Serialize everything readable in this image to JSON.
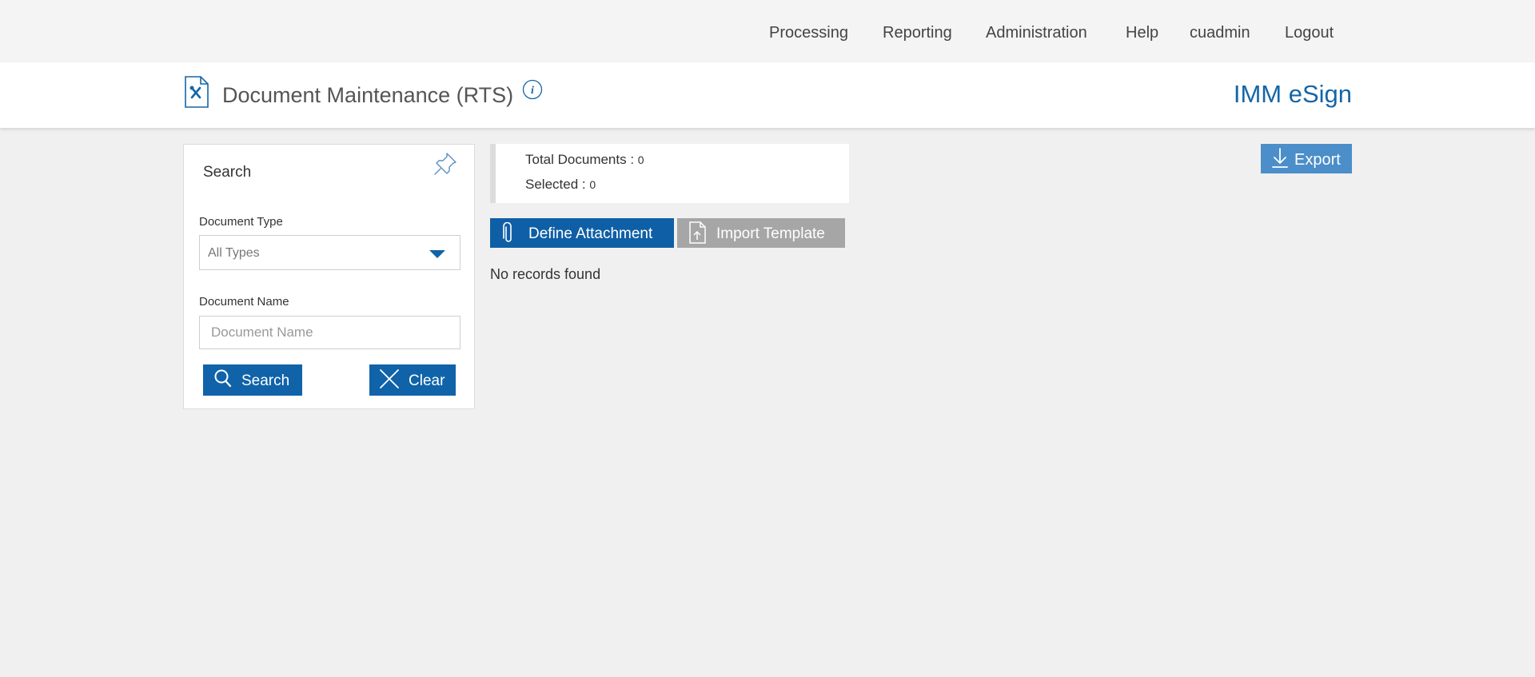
{
  "nav": {
    "items": [
      "Processing",
      "Reporting",
      "Administration",
      "Help",
      "cuadmin",
      "Logout"
    ]
  },
  "header": {
    "title": "Document Maintenance (RTS)",
    "brand": "IMM eSign",
    "icons": {
      "page": "document-tools-icon",
      "info": "info-icon"
    }
  },
  "search_panel": {
    "title": "Search",
    "pin_icon": "pin-icon",
    "document_type_label": "Document Type",
    "document_type_value": "All Types",
    "document_name_label": "Document Name",
    "document_name_placeholder": "Document Name",
    "document_name_value": "",
    "search_label": "Search",
    "clear_label": "Clear"
  },
  "summary": {
    "total_label": "Total Documents : ",
    "total_value": "0",
    "selected_label": "Selected : ",
    "selected_value": "0"
  },
  "actions": {
    "define_label": "Define Attachment",
    "import_label": "Import Template",
    "export_label": "Export"
  },
  "results": {
    "empty_message": "No records found"
  },
  "colors": {
    "primary": "#1063a9",
    "brand": "#1466a8",
    "disabled": "#a6a6a6",
    "export": "#4b8ec9",
    "background": "#f0f0f0"
  }
}
